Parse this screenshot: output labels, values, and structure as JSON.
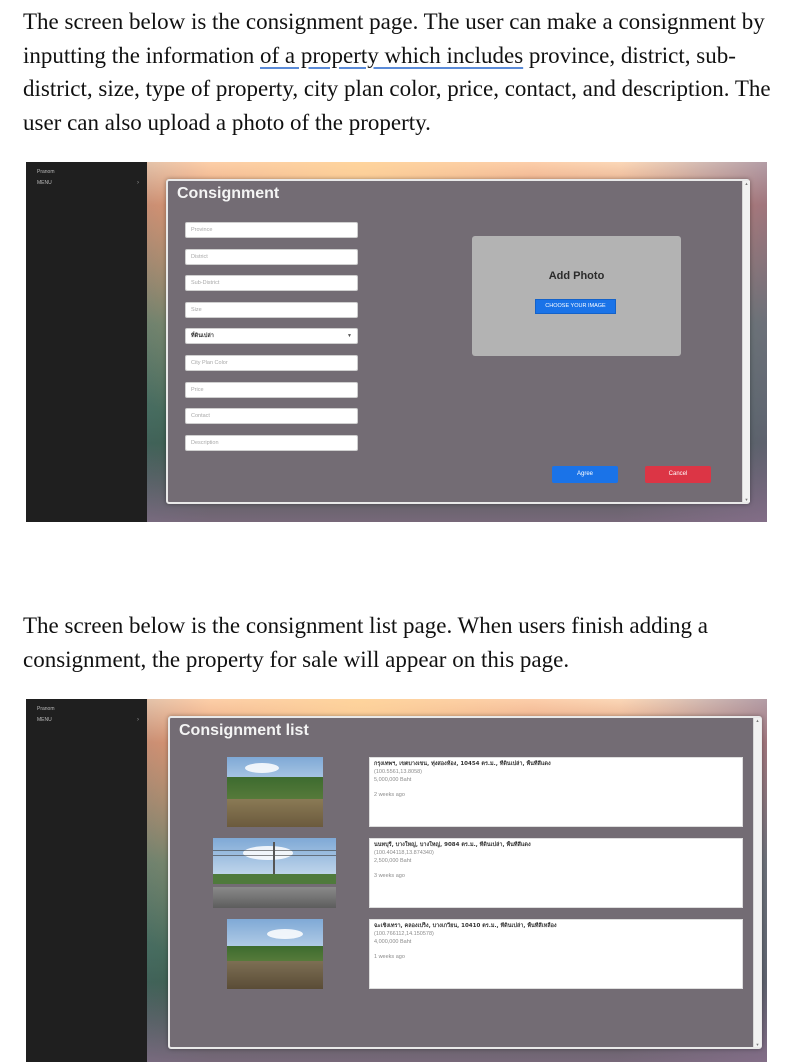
{
  "text": {
    "paragraph_1": "The screen below is the consignment page. The user can make a consignment by inputting the information of a property which includes province, district, sub-district, size, type of property, city plan color, price, contact, and description. The user can also upload a photo of the property.",
    "p1_before": "The screen below is the consignment page. The user can make a consignment by inputting the information ",
    "p1_underlined": "of a property which includes",
    "p1_after": " province, district, sub-district, size, type of property, city plan color, price, contact, and description. The user can also upload a photo of the property.",
    "paragraph_2": "The screen below is the consignment list page. When users finish adding a consignment, the property for sale will appear on this page."
  },
  "sidebar": {
    "user": "Pranom",
    "menu": "MENU",
    "menu_chevron": "›"
  },
  "consignment": {
    "title": "Consignment",
    "fields": [
      {
        "placeholder": "Province"
      },
      {
        "placeholder": "District"
      },
      {
        "placeholder": "Sub-District"
      },
      {
        "placeholder": "Size"
      },
      {
        "value": "ที่ดินเปล่า",
        "type": "select"
      },
      {
        "placeholder": "City Plan Color"
      },
      {
        "placeholder": "Price"
      },
      {
        "placeholder": "Contact"
      },
      {
        "placeholder": "Description"
      }
    ],
    "photo_title": "Add Photo",
    "photo_button": "CHOOSE YOUR IMAGE",
    "agree_button": "Agree",
    "cancel_button": "Cancel"
  },
  "consignment_list": {
    "title": "Consignment list",
    "items": [
      {
        "address": "กรุงเทพฯ, เขตบางเขน, ทุ่งสองห้อง, 10454 ตร.ม., ที่ดินเปล่า, พื้นที่สีแดง",
        "coords": "(100.5561,13.8058)",
        "price": "5,000,000 Baht",
        "time": "2 weeks ago"
      },
      {
        "address": "นนทบุรี, บางใหญ่, บางใหญ่, 9084 ตร.ม., ที่ดินเปล่า, พื้นที่สีแดง",
        "coords": "(100.404118,13.874340)",
        "price": "2,500,000 Baht",
        "time": "3 weeks ago"
      },
      {
        "address": "ฉะเชิงเทรา, คลองเปร็ง, บางเกวียน, 10410 ตร.ม., ที่ดินเปล่า, พื้นที่สีเหลือง",
        "coords": "(100.766112,14.150578)",
        "price": "4,000,000 Baht",
        "time": "1 weeks ago"
      }
    ]
  },
  "colors": {
    "panel": "#736c74",
    "primary": "#1a73e8",
    "danger": "#dc3545",
    "sidebar": "#1f1f1f"
  }
}
